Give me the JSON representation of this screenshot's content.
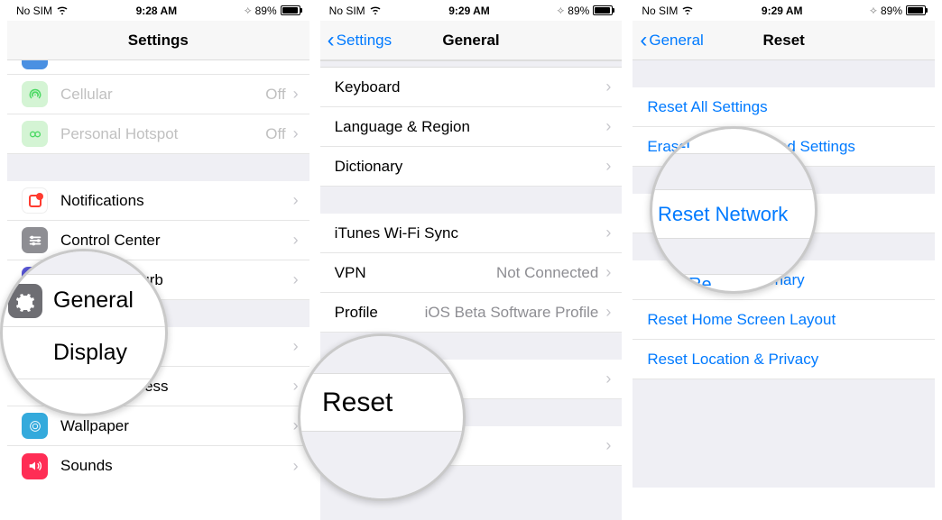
{
  "status": {
    "carrier": "No SIM",
    "battery": "89%"
  },
  "screen1": {
    "time": "9:28 AM",
    "title": "Settings",
    "items": [
      {
        "label": "Cellular",
        "detail": "Off"
      },
      {
        "label": "Personal Hotspot",
        "detail": "Off"
      },
      {
        "label": "Notifications"
      },
      {
        "label": "Control Center"
      },
      {
        "label": "Disturb"
      },
      {
        "label": "General"
      },
      {
        "label": "ghtness"
      },
      {
        "label": "Wallpaper"
      },
      {
        "label": "Sounds"
      }
    ],
    "magnify": {
      "top": "General",
      "bottom": "Display"
    }
  },
  "screen2": {
    "time": "9:29 AM",
    "back": "Settings",
    "title": "General",
    "items": [
      {
        "label": "Keyboard"
      },
      {
        "label": "Language & Region"
      },
      {
        "label": "Dictionary"
      },
      {
        "label": "iTunes Wi-Fi Sync"
      },
      {
        "label": "VPN",
        "detail": "Not Connected"
      },
      {
        "label": "Profile",
        "detail": "iOS Beta Software Profile"
      },
      {
        "label": "y"
      }
    ],
    "magnify": "Reset"
  },
  "screen3": {
    "time": "9:29 AM",
    "back": "General",
    "title": "Reset",
    "items": [
      {
        "label": "Reset All Settings"
      },
      {
        "label": "Erase All Content and Settings"
      },
      {
        "label": "Reset Network Settings",
        "visible": "ings"
      },
      {
        "label": "Reset Keyboard Dictionary",
        "visible": "oard Dictionary"
      },
      {
        "label": "Reset Home Screen Layout"
      },
      {
        "label": "Reset Location & Privacy"
      }
    ],
    "magnify": "Reset Network"
  }
}
